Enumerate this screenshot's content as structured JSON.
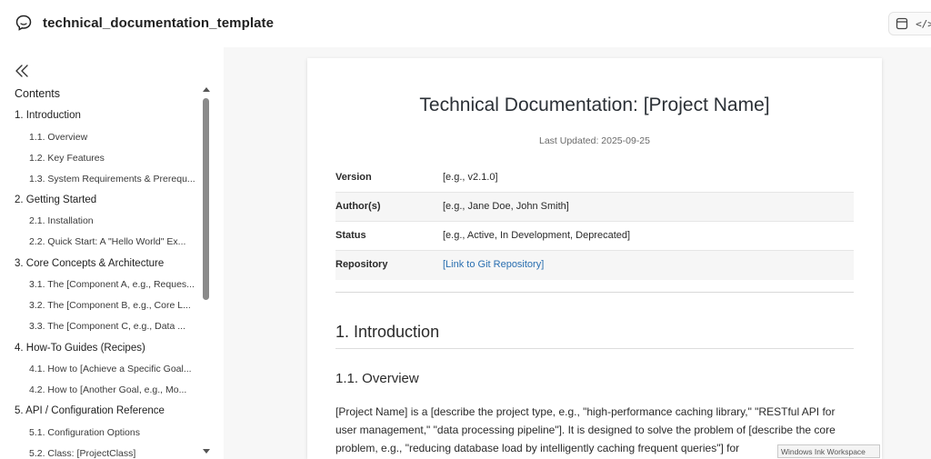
{
  "header": {
    "title": "technical_documentation_template",
    "icons": [
      "chat-bubble-icon",
      "window-icon",
      "code-icon"
    ],
    "code_label": "</>"
  },
  "sidebar": {
    "contents_label": "Contents",
    "toc": [
      {
        "level": 1,
        "label": "1. Introduction"
      },
      {
        "level": 2,
        "label": "1.1. Overview"
      },
      {
        "level": 2,
        "label": "1.2. Key Features"
      },
      {
        "level": 2,
        "label": "1.3. System Requirements & Prerequ..."
      },
      {
        "level": 1,
        "label": "2. Getting Started"
      },
      {
        "level": 2,
        "label": "2.1. Installation"
      },
      {
        "level": 2,
        "label": "2.2. Quick Start: A \"Hello World\" Ex..."
      },
      {
        "level": 1,
        "label": "3. Core Concepts & Architecture"
      },
      {
        "level": 2,
        "label": "3.1. The [Component A, e.g., Reques..."
      },
      {
        "level": 2,
        "label": "3.2. The [Component B, e.g., Core L..."
      },
      {
        "level": 2,
        "label": "3.3. The [Component C, e.g., Data ..."
      },
      {
        "level": 1,
        "label": "4. How-To Guides (Recipes)"
      },
      {
        "level": 2,
        "label": "4.1. How to [Achieve a Specific Goal..."
      },
      {
        "level": 2,
        "label": "4.2. How to [Another Goal, e.g., Mo..."
      },
      {
        "level": 1,
        "label": "5. API / Configuration Reference"
      },
      {
        "level": 2,
        "label": "5.1. Configuration Options"
      },
      {
        "level": 2,
        "label": "5.2. Class: [ProjectClass]"
      }
    ]
  },
  "document": {
    "title": "Technical Documentation: [Project Name]",
    "last_updated": "Last Updated: 2025-09-25",
    "meta": [
      {
        "key": "Version",
        "value": "[e.g., v2.1.0]"
      },
      {
        "key": "Author(s)",
        "value": "[e.g., Jane Doe, John Smith]"
      },
      {
        "key": "Status",
        "value": "[e.g., Active, In Development, Deprecated]"
      },
      {
        "key": "Repository",
        "value": "[Link to Git Repository]"
      }
    ],
    "section_heading": "1. Introduction",
    "subsection_heading": "1.1. Overview",
    "paragraph": "[Project Name] is a [describe the project type, e.g., \"high-performance caching library,\" \"RESTful API for user management,\" \"data processing pipeline\"]. It is designed to solve the problem of [describe the core problem, e.g., \"reducing database load by intelligently caching frequent queries\"] for"
  },
  "overlay": {
    "tooltip": "Windows Ink Workspace"
  },
  "colors": {
    "link": "#2a6fb0",
    "page_bg": "#f7f7f7",
    "scroll_thumb": "#8a8a8a"
  }
}
